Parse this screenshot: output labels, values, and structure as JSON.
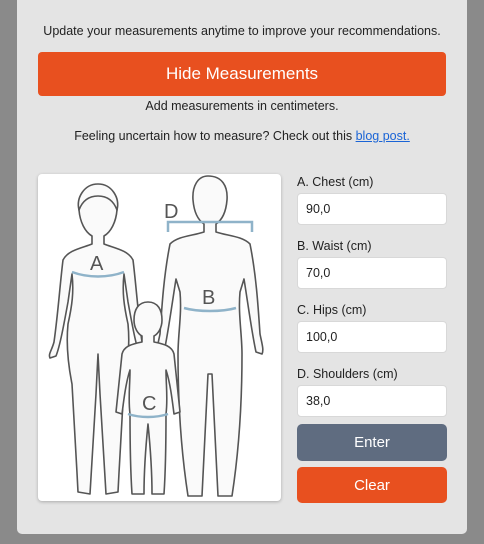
{
  "intro_text": "Update your measurements anytime to improve your recommendations.",
  "toggle_button_label": "Hide Measurements",
  "units_note": "Add measurements in centimeters.",
  "howto": {
    "text": "Feeling uncertain how to measure? Check out this ",
    "link_label": "blog post."
  },
  "diagram": {
    "labels": {
      "chest": "A",
      "waist": "B",
      "hips": "C",
      "shoulders": "D"
    },
    "measure_line_color": "#8fb3c9"
  },
  "fields": [
    {
      "label": "A. Chest (cm)",
      "value": "90,0"
    },
    {
      "label": "B. Waist (cm)",
      "value": "70,0"
    },
    {
      "label": "C. Hips (cm)",
      "value": "100,0"
    },
    {
      "label": "D. Shoulders (cm)",
      "value": "38,0"
    }
  ],
  "buttons": {
    "enter": "Enter",
    "clear": "Clear"
  },
  "colors": {
    "accent": "#e8501f",
    "enter_button": "#5f6c80",
    "link": "#1a64d6"
  }
}
